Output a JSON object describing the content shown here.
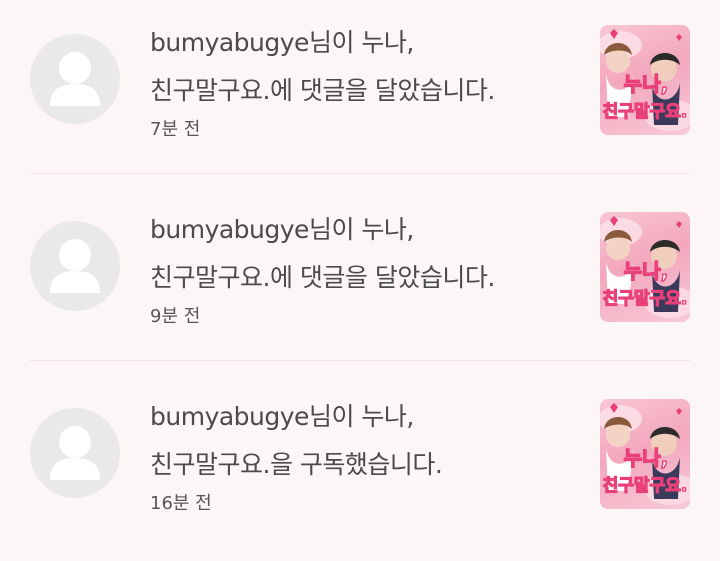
{
  "notifications": [
    {
      "user": "bumyabugye",
      "line1_suffix": "님이 누나,",
      "line2": "친구말구요.에 댓글을 달았습니다.",
      "time": "7분 전"
    },
    {
      "user": "bumyabugye",
      "line1_suffix": "님이 누나,",
      "line2": "친구말구요.에 댓글을 달았습니다.",
      "time": "9분 전"
    },
    {
      "user": "bumyabugye",
      "line1_suffix": "님이 누나,",
      "line2": "친구말구요.을 구독했습니다.",
      "time": "16분 전"
    }
  ],
  "thumbnail": {
    "title_line1": "누나,",
    "title_line2": "친구말구요."
  },
  "colors": {
    "background": "#fdf6f6",
    "divider": "#ece4e4",
    "avatar_bg": "#e9e9e9",
    "avatar_fg": "#ffffff",
    "thumb_pink": "#f3a7bd",
    "thumb_text": "#e9407a"
  },
  "icons": {
    "avatar": "default-user-silhouette-icon"
  }
}
